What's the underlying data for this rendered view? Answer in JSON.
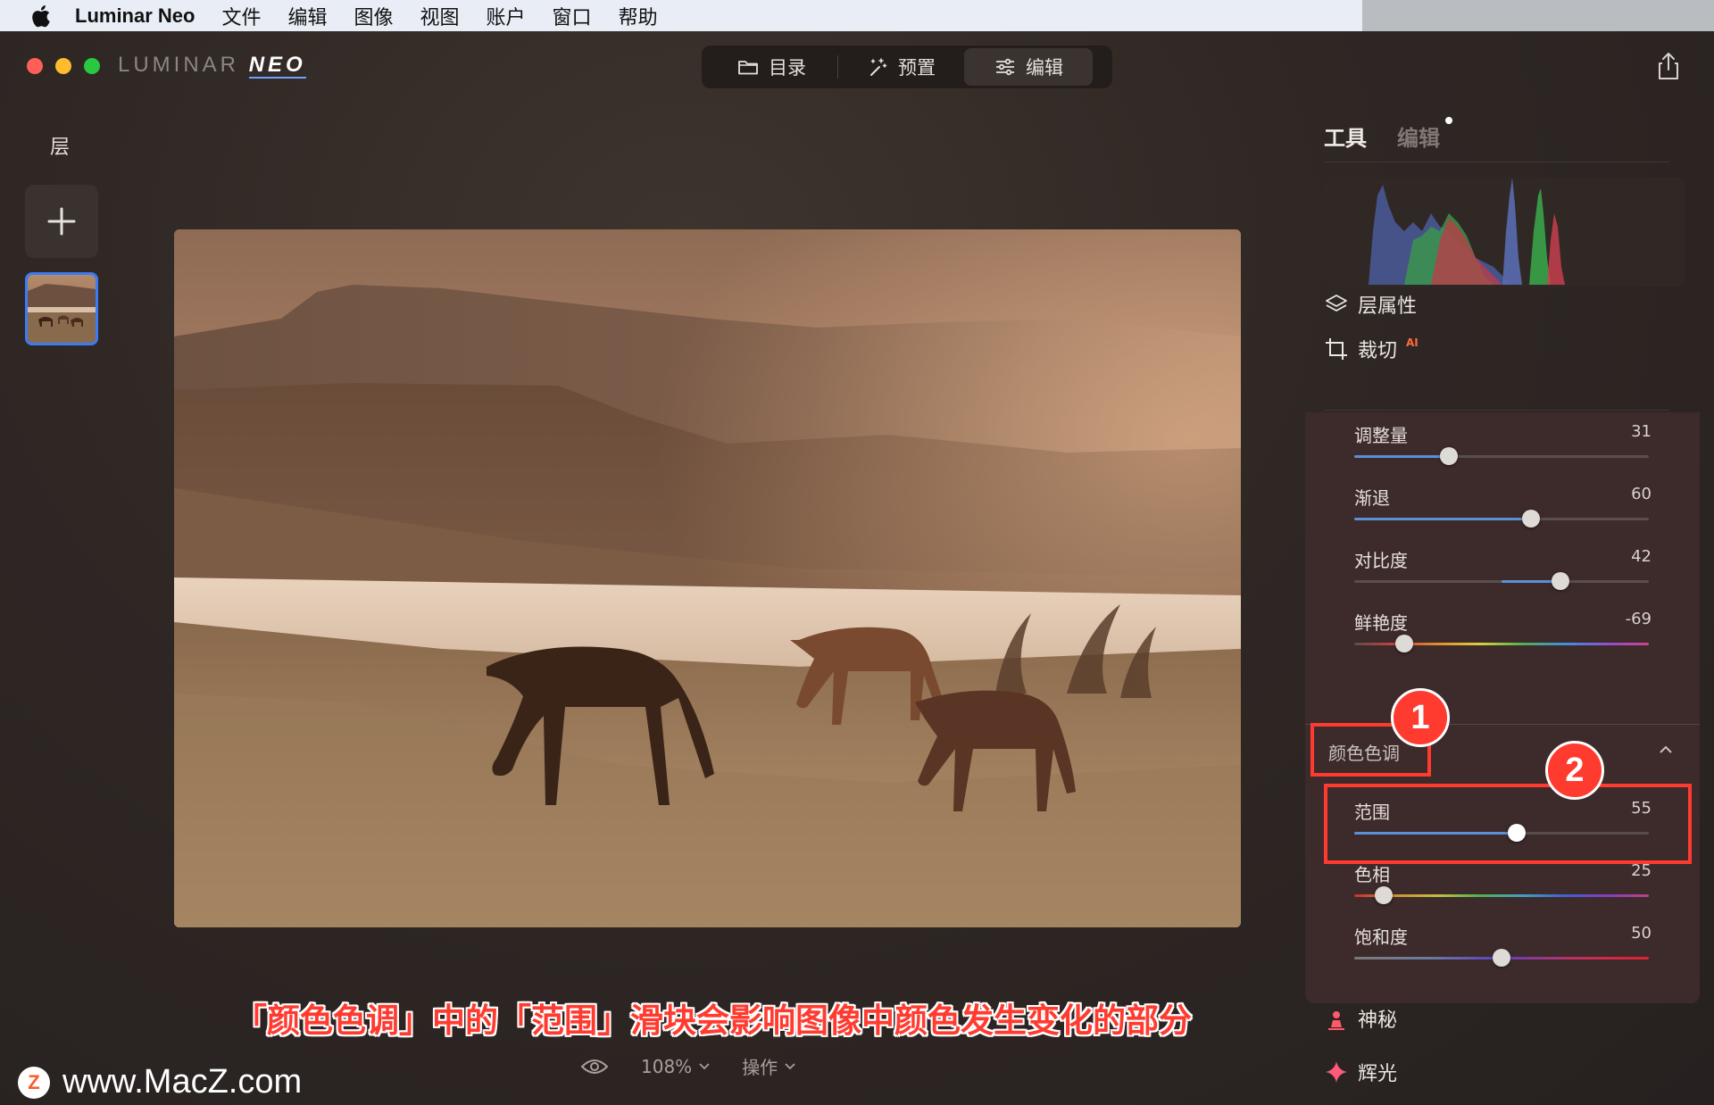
{
  "menubar": {
    "app_name": "Luminar Neo",
    "items": [
      "文件",
      "编辑",
      "图像",
      "视图",
      "账户",
      "窗口",
      "帮助"
    ]
  },
  "logo": {
    "main": "LUMINAR",
    "accent": "NEO"
  },
  "modes": [
    {
      "label": "目录",
      "icon": "folder-icon"
    },
    {
      "label": "预置",
      "icon": "magic-wand-icon"
    },
    {
      "label": "编辑",
      "icon": "sliders-icon",
      "active": true
    }
  ],
  "layers_panel": {
    "title": "层"
  },
  "right_panel": {
    "tabs": {
      "tools": "工具",
      "edits": "编辑"
    },
    "tools": [
      {
        "label": "层属性",
        "icon": "layers-icon"
      },
      {
        "label": "裁切",
        "icon": "crop-icon",
        "tag": "AI"
      }
    ],
    "sliders_top": [
      {
        "label": "调整量",
        "value": "31",
        "fraction": 0.32,
        "style": "blue"
      },
      {
        "label": "渐退",
        "value": "60",
        "fraction": 0.6,
        "style": "blue"
      },
      {
        "label": "对比度",
        "value": "42",
        "fraction": 0.7,
        "style": "blue-center"
      },
      {
        "label": "鲜艳度",
        "value": "-69",
        "fraction": 0.17,
        "style": "rainbow"
      }
    ],
    "color_tone": {
      "title": "颜色色调",
      "sliders": [
        {
          "label": "范围",
          "value": "55",
          "fraction": 0.55,
          "style": "blue"
        },
        {
          "label": "色相",
          "value": "25",
          "fraction": 0.1,
          "style": "hue"
        },
        {
          "label": "饱和度",
          "value": "50",
          "fraction": 0.5,
          "style": "sat"
        }
      ]
    },
    "bottom_tools": [
      {
        "label": "神秘",
        "icon": "mystical-icon"
      },
      {
        "label": "辉光",
        "icon": "sparkle-icon"
      }
    ]
  },
  "bottom_bar": {
    "zoom": "108%",
    "actions": "操作"
  },
  "annotations": {
    "caption": "「颜色色调」中的「范围」滑块会影响图像中颜色发生变化的部分",
    "badge1": "1",
    "badge2": "2"
  },
  "watermark": {
    "logo_letter": "Z",
    "text": "www.MacZ.com"
  },
  "colors": {
    "accent_blue": "#3b7cf6",
    "annotation_red": "#ff3b30",
    "panel_bg": "#3d2a2a"
  }
}
